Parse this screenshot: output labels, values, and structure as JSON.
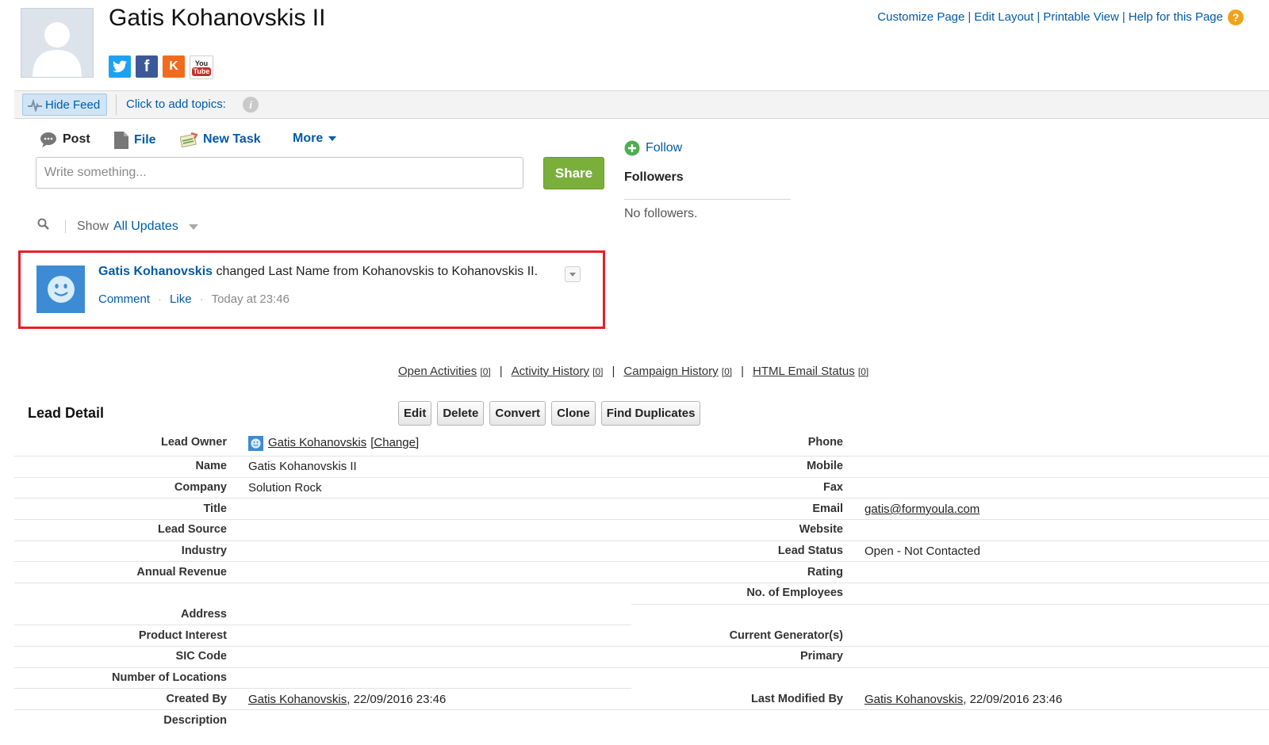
{
  "header": {
    "title": "Gatis Kohanovskis II",
    "social": [
      "twitter-icon",
      "facebook-icon",
      "klout-icon",
      "youtube-icon"
    ],
    "social_text": {
      "facebook": "f",
      "klout": "K",
      "yt_top": "You",
      "yt_bottom": "Tube"
    },
    "links": [
      "Customize Page",
      "Edit Layout",
      "Printable View",
      "Help for this Page"
    ],
    "link_sep": "|",
    "help_glyph": "?"
  },
  "feed_bar": {
    "hide_feed": "Hide Feed",
    "add_topics": "Click to add topics:",
    "info_glyph": "i"
  },
  "publisher": {
    "tabs": [
      "Post",
      "File",
      "New Task",
      "More"
    ],
    "placeholder": "Write something...",
    "share": "Share"
  },
  "filter": {
    "show_label": "Show",
    "show_value": "All Updates"
  },
  "feed_item": {
    "author": "Gatis Kohanovskis",
    "text": " changed Last Name from Kohanovskis to Kohanovskis II.",
    "comment": "Comment",
    "like": "Like",
    "dot": "·",
    "time": "Today at 23:46"
  },
  "followers": {
    "follow": "Follow",
    "heading": "Followers",
    "none": "No followers."
  },
  "related_lists": [
    {
      "label": "Open Activities",
      "count": "[0]"
    },
    {
      "label": "Activity History",
      "count": "[0]"
    },
    {
      "label": "Campaign History",
      "count": "[0]"
    },
    {
      "label": "HTML Email Status",
      "count": "[0]"
    }
  ],
  "related_sep": "|",
  "detail": {
    "title": "Lead Detail",
    "buttons": [
      "Edit",
      "Delete",
      "Convert",
      "Clone",
      "Find Duplicates"
    ],
    "left": [
      {
        "label": "Lead Owner",
        "value": "Gatis Kohanovskis",
        "extra": "[Change]"
      },
      {
        "label": "Name",
        "value": "Gatis Kohanovskis II"
      },
      {
        "label": "Company",
        "value": "Solution Rock"
      },
      {
        "label": "Title",
        "value": ""
      },
      {
        "label": "Lead Source",
        "value": ""
      },
      {
        "label": "Industry",
        "value": ""
      },
      {
        "label": "Annual Revenue",
        "value": ""
      },
      {
        "label": "Address",
        "value": ""
      },
      {
        "label": "Product Interest",
        "value": ""
      },
      {
        "label": "SIC Code",
        "value": ""
      },
      {
        "label": "Number of Locations",
        "value": ""
      },
      {
        "label": "Created By",
        "value": "Gatis Kohanovskis",
        "extra": ", 22/09/2016 23:46"
      },
      {
        "label": "Description",
        "value": ""
      }
    ],
    "right": [
      {
        "label": "Phone",
        "value": ""
      },
      {
        "label": "Mobile",
        "value": ""
      },
      {
        "label": "Fax",
        "value": ""
      },
      {
        "label": "Email",
        "value": "gatis@formyoula.com"
      },
      {
        "label": "Website",
        "value": ""
      },
      {
        "label": "Lead Status",
        "value": "Open - Not Contacted"
      },
      {
        "label": "Rating",
        "value": ""
      },
      {
        "label": "No. of Employees",
        "value": ""
      },
      {
        "label": "Current Generator(s)",
        "value": ""
      },
      {
        "label": "Primary",
        "value": ""
      },
      {
        "label": "Last Modified By",
        "value": "Gatis Kohanovskis",
        "extra": ", 22/09/2016 23:46"
      }
    ]
  }
}
